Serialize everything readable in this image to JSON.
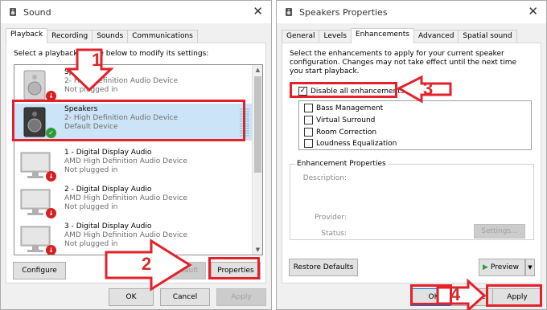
{
  "sound_window": {
    "title": "Sound",
    "close": "✕",
    "tabs": [
      "Playback",
      "Recording",
      "Sounds",
      "Communications"
    ],
    "instruction": "Select a playback device below to modify its settings:",
    "devices": [
      {
        "name": "Speakers",
        "description": "2- High Definition Audio Device",
        "status": "Not plugged in",
        "icon": "speaker-icon",
        "badge": "unplugged"
      },
      {
        "name": "Speakers",
        "description": "2- High Definition Audio Device",
        "status": "Default Device",
        "icon": "speaker-icon",
        "badge": "default"
      },
      {
        "name": "1 - Digital Display Audio",
        "description": "AMD High Definition Audio Device",
        "status": "Not plugged in",
        "icon": "monitor-icon",
        "badge": "unplugged"
      },
      {
        "name": "2 - Digital Display Audio",
        "description": "AMD High Definition Audio Device",
        "status": "Not plugged in",
        "icon": "monitor-icon",
        "badge": "unplugged"
      },
      {
        "name": "3 - Digital Display Audio",
        "description": "AMD High Definition Audio Device",
        "status": "Not plugged in",
        "icon": "monitor-icon",
        "badge": "unplugged"
      }
    ],
    "buttons": {
      "configure": "Configure",
      "set_default": "Set Default",
      "properties": "Properties",
      "ok": "OK",
      "cancel": "Cancel",
      "apply": "Apply"
    }
  },
  "speakers_window": {
    "title": "Speakers Properties",
    "close": "✕",
    "tabs": [
      "General",
      "Levels",
      "Enhancements",
      "Advanced",
      "Spatial sound"
    ],
    "instruction": "Select the enhancements to apply for your current speaker configuration. Changes may not take effect until the next time you start playback.",
    "disable_all": {
      "label": "Disable all enhancements",
      "checked": true
    },
    "enhancements": [
      "Bass Management",
      "Virtual Surround",
      "Room Correction",
      "Loudness Equalization"
    ],
    "properties_group": {
      "legend": "Enhancement Properties",
      "description_label": "Description:",
      "provider_label": "Provider:",
      "status_label": "Status:",
      "settings_button": "Settings..."
    },
    "buttons": {
      "restore_defaults": "Restore Defaults",
      "preview": "Preview",
      "ok": "OK",
      "cancel": "Cancel",
      "apply": "Apply"
    }
  },
  "callouts": [
    "1",
    "2",
    "3",
    "4"
  ],
  "colors": {
    "highlight": "#e4202a",
    "selection": "#cce4f7",
    "window_bg": "#f0f0f0"
  }
}
